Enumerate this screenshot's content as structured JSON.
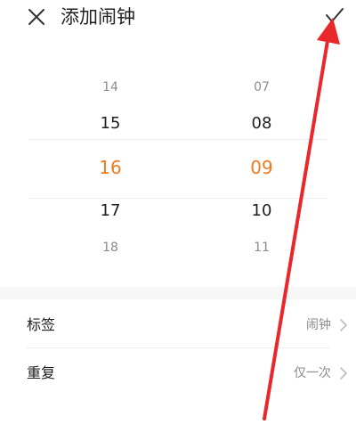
{
  "header": {
    "title": "添加闹钟",
    "close_icon": "close-icon",
    "confirm_icon": "check-icon"
  },
  "picker": {
    "hours": [
      "14",
      "15",
      "16",
      "17",
      "18"
    ],
    "minutes": [
      "07",
      "08",
      "09",
      "10",
      "11"
    ],
    "selected_hour": "16",
    "selected_minute": "09"
  },
  "settings": [
    {
      "label": "标签",
      "value": "闹钟"
    },
    {
      "label": "重复",
      "value": "仅一次"
    }
  ],
  "colors": {
    "accent": "#f07a1e",
    "annotation_arrow": "#e8282a"
  }
}
